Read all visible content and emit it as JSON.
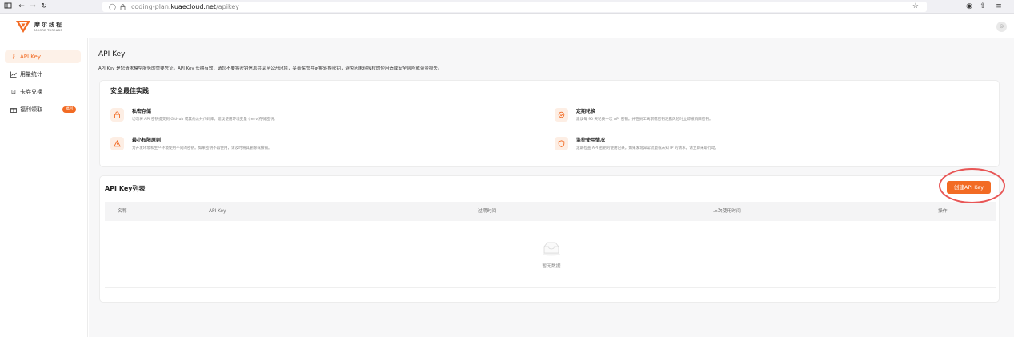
{
  "browser": {
    "url_prefix": "coding-plan.",
    "url_host": "kuaecloud.net",
    "url_path": "/apikey"
  },
  "brand": {
    "name_cn": "摩尔线程",
    "name_en": "MOORE THREADS",
    "accent_color": "#f26b24"
  },
  "sidebar": {
    "items": [
      {
        "label": "API Key",
        "icon": "key-icon",
        "active": true
      },
      {
        "label": "用量统计",
        "icon": "chart-icon",
        "active": false
      },
      {
        "label": "卡券兑换",
        "icon": "coupon-icon",
        "active": false
      },
      {
        "label": "福利领取",
        "icon": "gift-icon",
        "active": false,
        "badge": "福利"
      }
    ]
  },
  "page": {
    "title": "API Key",
    "description": "API Key 是您请求模型服务的重要凭证。API Key 长期有效，请您不要将密钥信息共享至公开环境，妥善保管并定期轮换密钥，避免因未经授权的使用造成安全风险或资金损失。"
  },
  "practices": {
    "title": "安全最佳实践",
    "items": [
      {
        "title": "私密存储",
        "desc": "切勿将 API 密钥提交到 GitHub 或其他公共代码库。建议使用环境变量 (.env)存储密钥。",
        "icon": "lock-icon"
      },
      {
        "title": "定期轮换",
        "desc": "建议每 90 天轮换一次 API 密钥。并在员工离职或密钥泄露风险时立即撤销旧密钥。",
        "icon": "refresh-icon"
      },
      {
        "title": "最小权限原则",
        "desc": "为开发环境和生产环境使用不同的密钥。如果密钥不再使用，请及时将其删除或撤销。",
        "icon": "warning-icon"
      },
      {
        "title": "监控使用情况",
        "desc": "定期检查 API 密钥的使用记录。如果发现异常流量或未知 IP 的请求，请立即采取行动。",
        "icon": "shield-icon"
      }
    ]
  },
  "api_list": {
    "title": "API Key列表",
    "create_label": "创建API Key",
    "columns": [
      "名称",
      "API Key",
      "过期时间",
      "上次使用时间",
      "操作"
    ],
    "empty_text": "暂无数据"
  }
}
